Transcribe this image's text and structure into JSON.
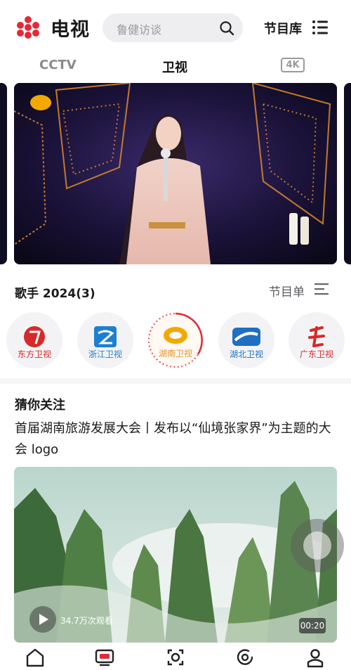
{
  "header": {
    "app_title": "电视",
    "search_placeholder": "鲁健访谈",
    "library_label": "节目库"
  },
  "tabs": [
    {
      "label": "CCTV",
      "active": false
    },
    {
      "label": "卫视",
      "active": true
    },
    {
      "label": "4K",
      "active": false
    }
  ],
  "program": {
    "title": "歌手 2024(3)",
    "schedule_label": "节目单"
  },
  "channels": [
    {
      "name": "东方卫视",
      "color": "#d62a2a",
      "active": false
    },
    {
      "name": "浙江卫视",
      "color": "#1e7fd0",
      "active": false
    },
    {
      "name": "湖南卫视",
      "color": "#f2a800",
      "active": true
    },
    {
      "name": "湖北卫视",
      "color": "#1f6fc2",
      "active": false
    },
    {
      "name": "广东卫视",
      "color": "#d62a2a",
      "active": false
    }
  ],
  "recommend": {
    "label": "猜你关注",
    "headline": "首届湖南旅游发展大会丨发布以“仙境张家界”为主题的大会 logo",
    "views": "34.7万次观看",
    "duration": "00:20"
  },
  "colors": {
    "accent": "#e3293a",
    "nav_active": "#e3293a"
  },
  "bottom_nav": [
    {
      "icon": "home-icon"
    },
    {
      "icon": "tv-icon",
      "active": true
    },
    {
      "icon": "live-icon"
    },
    {
      "icon": "replay-icon"
    },
    {
      "icon": "profile-icon"
    }
  ]
}
